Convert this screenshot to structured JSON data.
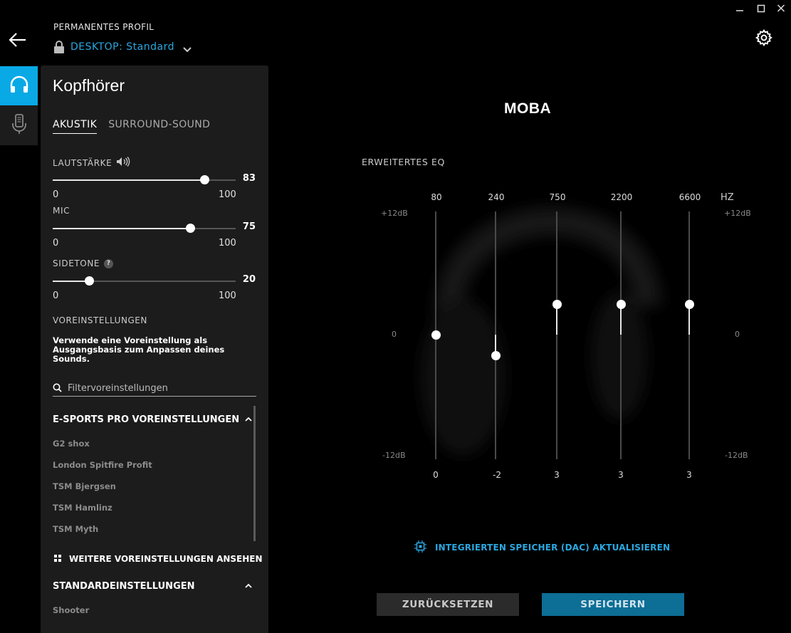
{
  "window": {
    "minimize_icon": "minimize-icon",
    "maximize_icon": "maximize-icon",
    "close_icon": "close-icon"
  },
  "header": {
    "profile_label": "PERMANENTES PROFIL",
    "profile_prefix": "DESKTOP:",
    "profile_name": "Standard"
  },
  "rail": {
    "items": [
      {
        "icon": "headphones-icon",
        "active": true
      },
      {
        "icon": "microphone-icon",
        "active": false
      }
    ]
  },
  "panel": {
    "title": "Kopfhörer",
    "tabs": [
      {
        "label": "AKUSTIK",
        "active": true
      },
      {
        "label": "SURROUND-SOUND",
        "active": false
      }
    ],
    "sliders": [
      {
        "label": "LAUTSTÄRKE",
        "value": "83",
        "min": "0",
        "max": "100",
        "level": 83
      },
      {
        "label": "MIC",
        "value": "75",
        "min": "0",
        "max": "100",
        "level": 75
      },
      {
        "label": "SIDETONE",
        "value": "20",
        "min": "0",
        "max": "100",
        "level": 20
      }
    ],
    "help_glyph": "?",
    "presets_heading": "VOREINSTELLUNGEN",
    "presets_description": "Verwende eine Voreinstellung als Ausgangsbasis zum Anpassen deines Sounds.",
    "search_placeholder": "Filtervoreinstellungen",
    "esports_group": {
      "title": "E-SPORTS PRO VOREINSTELLUNGEN",
      "items": [
        "G2 shox",
        "London Spitfire Profit",
        "TSM Bjergsen",
        "TSM Hamlinz",
        "TSM Myth"
      ]
    },
    "more_presets": "WEITERE VOREINSTELLUNGEN ANSEHEN",
    "default_group": {
      "title": "STANDARDEINSTELLUNGEN",
      "items": [
        "Shooter"
      ]
    }
  },
  "eq": {
    "preset_name": "MOBA",
    "subtitle": "ERWEITERTES EQ",
    "unit": "HZ",
    "db_top": "+12dB",
    "db_mid": "0",
    "db_bottom": "-12dB",
    "range": [
      -12,
      12
    ],
    "bands": [
      {
        "freq": "80",
        "value": "0",
        "gain": 0
      },
      {
        "freq": "240",
        "value": "-2",
        "gain": -2
      },
      {
        "freq": "750",
        "value": "3",
        "gain": 3
      },
      {
        "freq": "2200",
        "value": "3",
        "gain": 3
      },
      {
        "freq": "6600",
        "value": "3",
        "gain": 3
      }
    ]
  },
  "dac_link": "INTEGRIERTEN SPEICHER (DAC) AKTUALISIEREN",
  "buttons": {
    "reset": "ZURÜCKSETZEN",
    "save": "SPEICHERN"
  },
  "colors": {
    "accent": "#09a9e6",
    "link": "#2aa8e0",
    "panel": "#1c1c1c",
    "save_button": "#0d6e96"
  }
}
